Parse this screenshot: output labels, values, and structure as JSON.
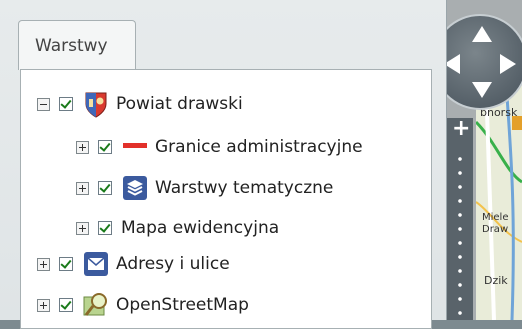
{
  "panel": {
    "tab_label": "Warstwy"
  },
  "layers": [
    {
      "label": "Powiat drawski",
      "expander": "minus",
      "checked": true,
      "icon": "coat-of-arms-icon"
    },
    {
      "label": "Granice administracyjne",
      "expander": "plus",
      "checked": true,
      "icon": "boundary-line-icon"
    },
    {
      "label": "Warstwy tematyczne",
      "expander": "plus",
      "checked": true,
      "icon": "layers-stack-icon"
    },
    {
      "label": "Mapa ewidencyjna",
      "expander": "plus",
      "checked": true,
      "icon": ""
    },
    {
      "label": "Adresy i ulice",
      "expander": "plus",
      "checked": true,
      "icon": "envelope-icon"
    },
    {
      "label": "OpenStreetMap",
      "expander": "plus",
      "checked": true,
      "icon": "map-magnifier-icon"
    }
  ],
  "map": {
    "zoom_in_symbol": "+",
    "labels": [
      "bnorsk",
      "Miele",
      "Draw",
      "Dzik"
    ]
  },
  "colors": {
    "panel_bg": "#e4e8ea",
    "tree_bg": "#ffffff",
    "boundary_red": "#e2302a",
    "layers_blue": "#3b5a9e",
    "check_green": "#1a7a1a"
  }
}
